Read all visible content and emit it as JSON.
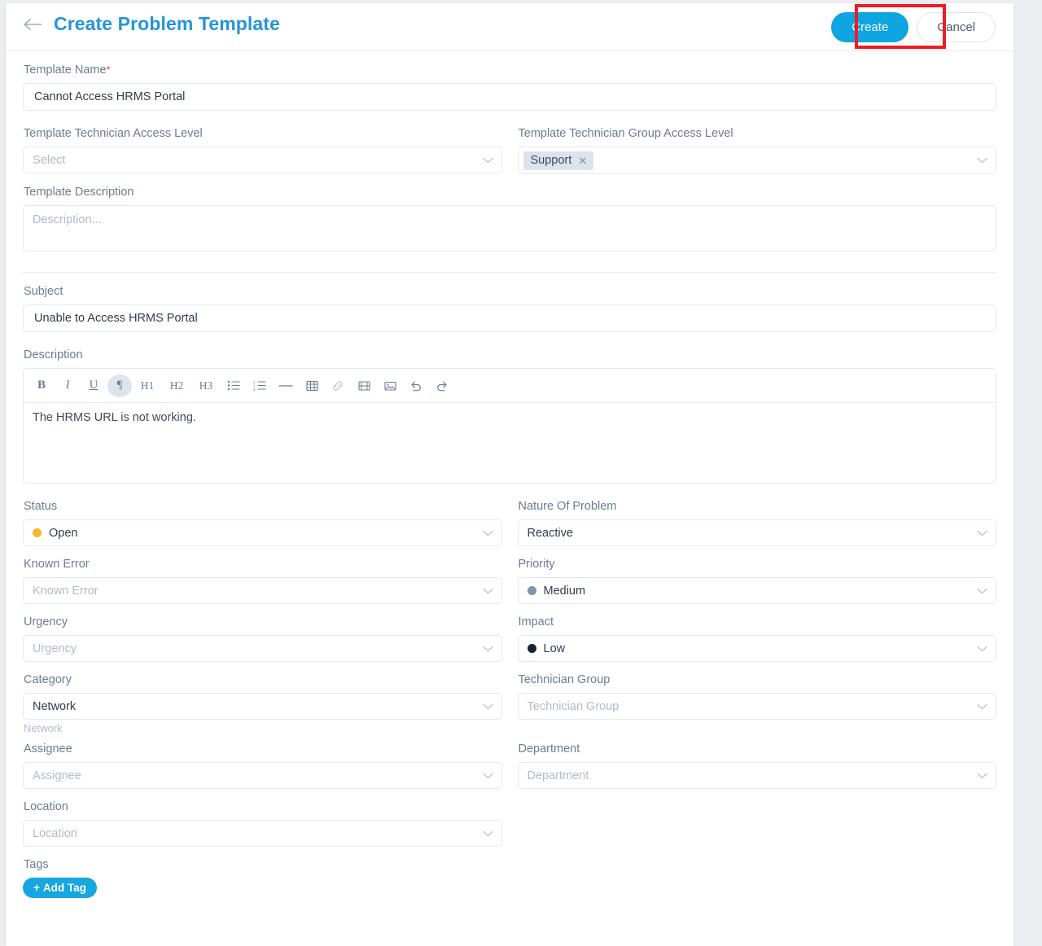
{
  "header": {
    "back_icon": "arrow-left-icon",
    "title": "Create Problem Template",
    "create_label": "Create",
    "cancel_label": "Cancel",
    "accent_color": "#0ea5e0",
    "title_color": "#2494d8",
    "annotation_color": "#ed1c24"
  },
  "form": {
    "template_name": {
      "label": "Template Name",
      "required_mark": "*",
      "value": "Cannot Access HRMS Portal"
    },
    "template_technician_access_level": {
      "label": "Template Technician Access Level",
      "placeholder": "Select",
      "value": ""
    },
    "template_technician_group_access_level": {
      "label": "Template Technician Group Access Level",
      "chips": [
        "Support"
      ],
      "chip_remove_icon": "close-icon"
    },
    "template_description": {
      "label": "Template Description",
      "placeholder": "Description...",
      "value": ""
    },
    "subject": {
      "label": "Subject",
      "value": "Unable to Access HRMS Portal"
    },
    "description": {
      "label": "Description",
      "content": "The HRMS URL is not working.",
      "toolbar": [
        {
          "name": "bold-icon",
          "glyph": "B",
          "active": false
        },
        {
          "name": "italic-icon",
          "glyph": "I",
          "active": false
        },
        {
          "name": "underline-icon",
          "glyph": "U",
          "active": false
        },
        {
          "name": "paragraph-icon",
          "glyph": "¶",
          "active": true
        },
        {
          "name": "heading-1-icon",
          "glyph": "H1",
          "active": false
        },
        {
          "name": "heading-2-icon",
          "glyph": "H2",
          "active": false
        },
        {
          "name": "heading-3-icon",
          "glyph": "H3",
          "active": false
        },
        {
          "name": "bulleted-list-icon",
          "glyph": "",
          "active": false
        },
        {
          "name": "numbered-list-icon",
          "glyph": "",
          "active": false
        },
        {
          "name": "horizontal-rule-icon",
          "glyph": "",
          "active": false
        },
        {
          "name": "table-icon",
          "glyph": "",
          "active": false
        },
        {
          "name": "link-icon",
          "glyph": "",
          "active": false
        },
        {
          "name": "video-icon",
          "glyph": "",
          "active": false
        },
        {
          "name": "image-icon",
          "glyph": "",
          "active": false
        },
        {
          "name": "undo-icon",
          "glyph": "",
          "active": false
        },
        {
          "name": "redo-icon",
          "glyph": "",
          "active": false
        }
      ]
    },
    "status": {
      "label": "Status",
      "value": "Open",
      "dot_color": "#f5b82e"
    },
    "nature_of_problem": {
      "label": "Nature Of Problem",
      "value": "Reactive"
    },
    "known_error": {
      "label": "Known Error",
      "placeholder": "Known Error",
      "value": ""
    },
    "priority": {
      "label": "Priority",
      "value": "Medium",
      "dot_color": "#8194ae"
    },
    "urgency": {
      "label": "Urgency",
      "placeholder": "Urgency",
      "value": ""
    },
    "impact": {
      "label": "Impact",
      "value": "Low",
      "dot_color": "#1b2333"
    },
    "category": {
      "label": "Category",
      "value": "Network",
      "helper": "Network"
    },
    "technician_group": {
      "label": "Technician Group",
      "placeholder": "Technician Group",
      "value": ""
    },
    "assignee": {
      "label": "Assignee",
      "placeholder": "Assignee",
      "value": ""
    },
    "department": {
      "label": "Department",
      "placeholder": "Department",
      "value": ""
    },
    "location": {
      "label": "Location",
      "placeholder": "Location",
      "value": ""
    },
    "tags": {
      "label": "Tags",
      "add_label": "Add Tag",
      "add_icon": "plus-icon"
    }
  }
}
